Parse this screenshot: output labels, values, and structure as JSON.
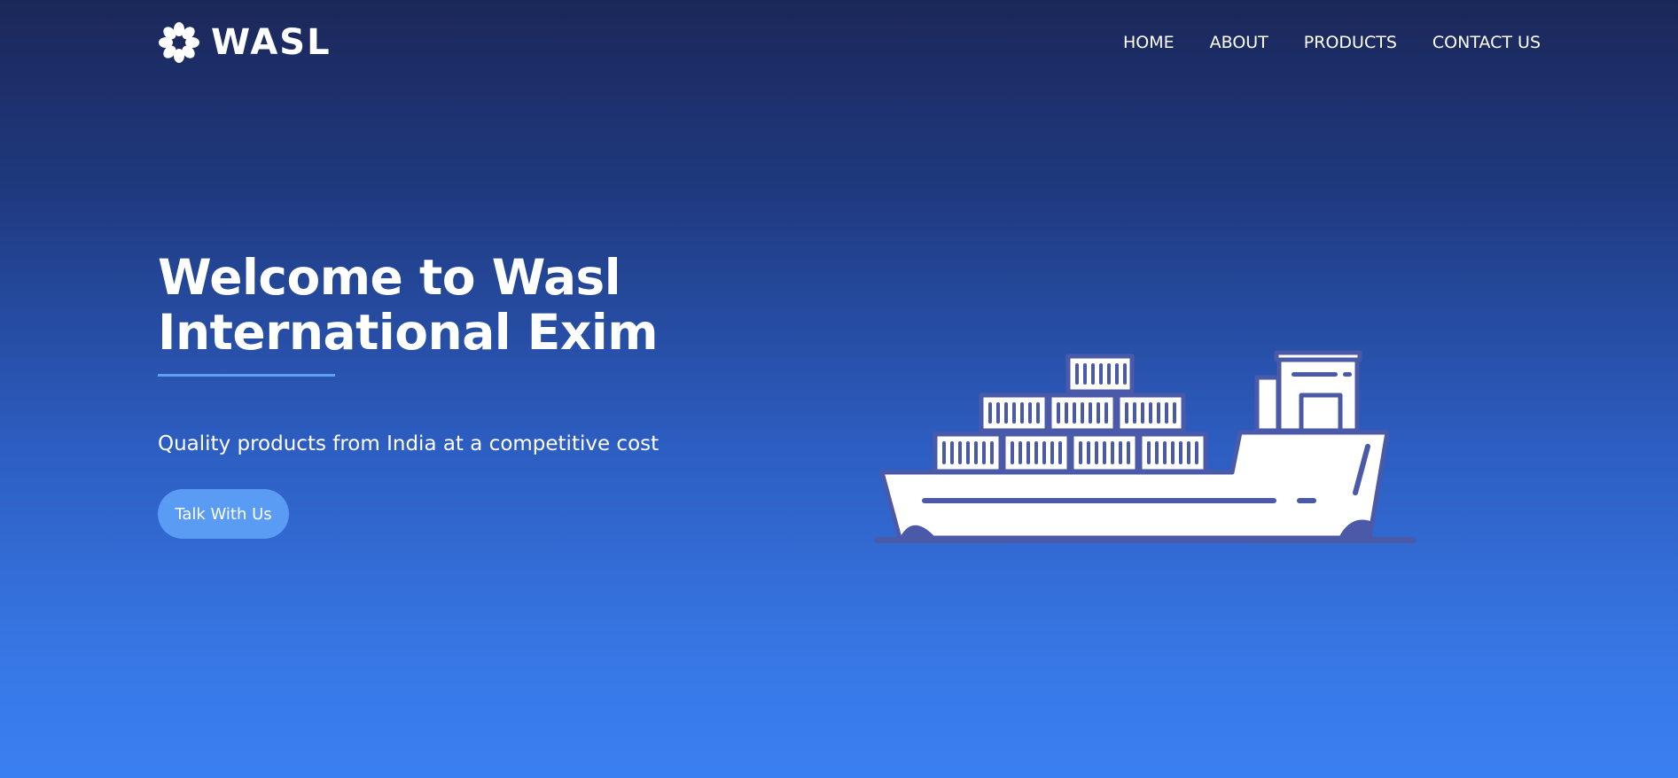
{
  "brand": {
    "name": "WASL",
    "icon": "flower-logo-icon"
  },
  "nav": {
    "items": [
      {
        "label": "HOME"
      },
      {
        "label": "ABOUT"
      },
      {
        "label": "PRODUCTS"
      },
      {
        "label": "CONTACT US"
      }
    ]
  },
  "hero": {
    "title_line1": "Welcome to Wasl",
    "title_line2": "International Exim",
    "subtitle": "Quality products from India at a competitive cost",
    "cta_label": "Talk With Us",
    "illustration": "cargo-ship-icon"
  },
  "colors": {
    "background_top": "#1b2759",
    "background_bottom": "#3a7ff2",
    "accent": "#5a9cf3",
    "underline": "#5fa0f5",
    "ship_outline": "#4a5aa8",
    "text": "#ffffff"
  }
}
